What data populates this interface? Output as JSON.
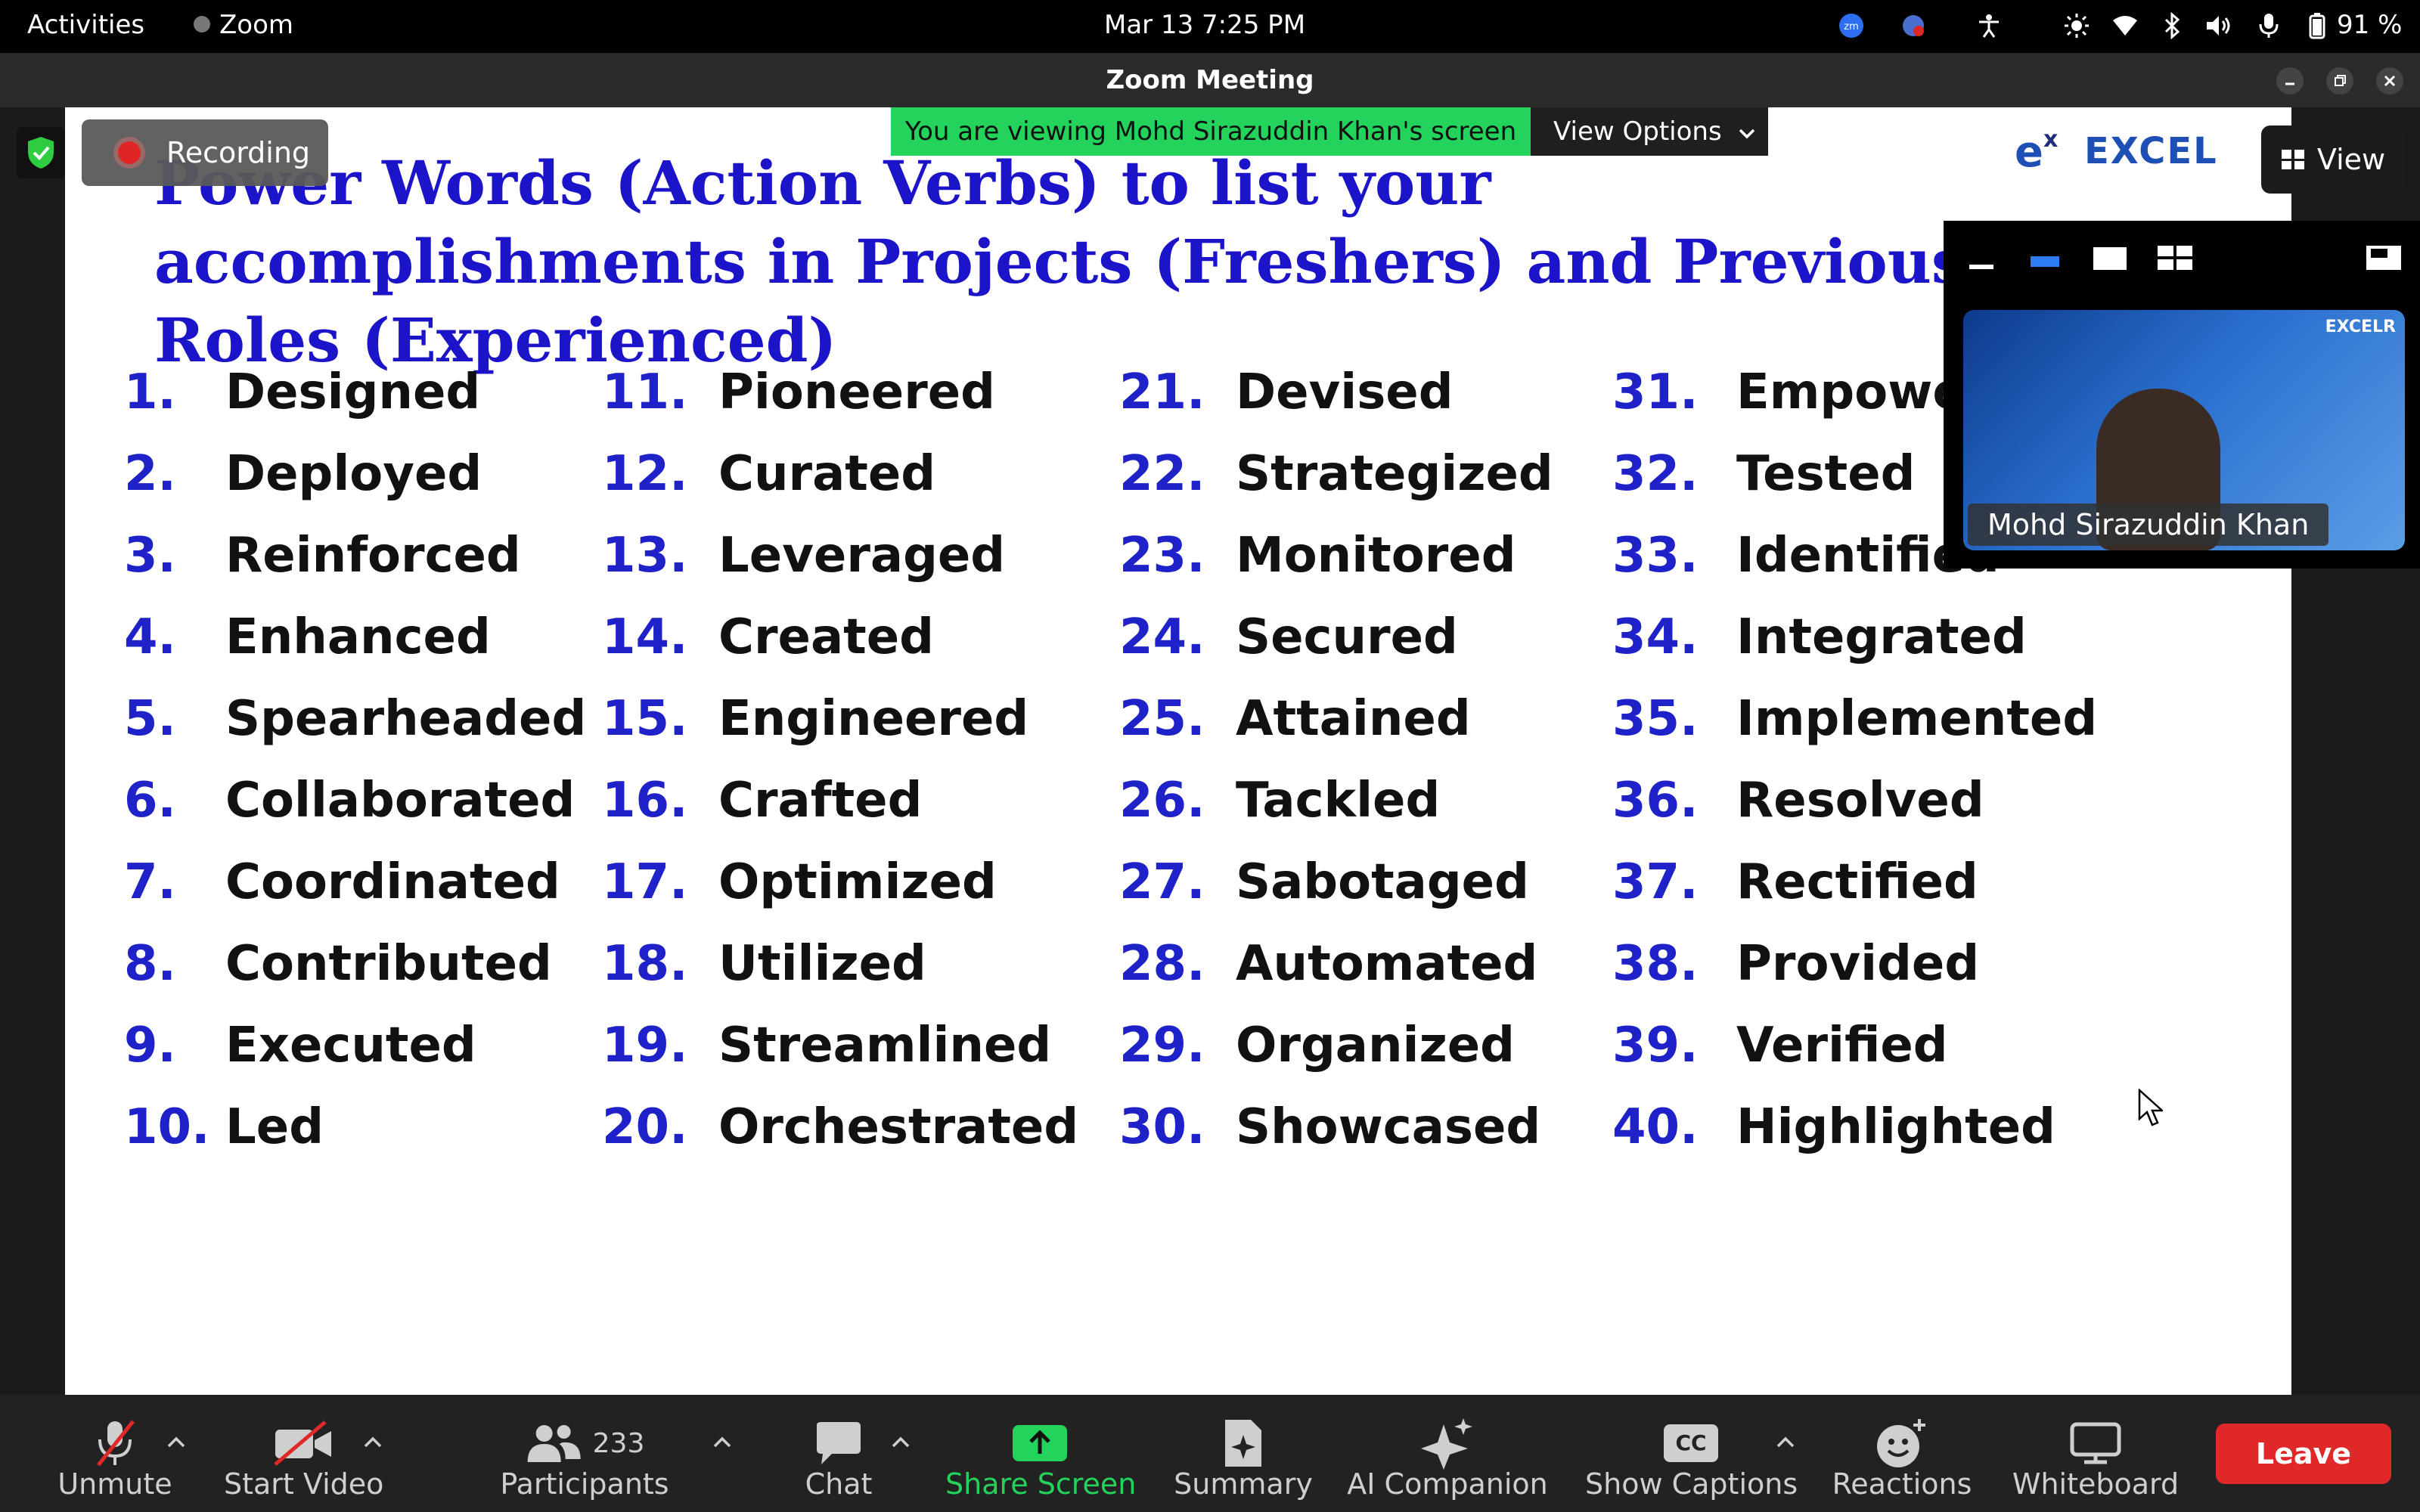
{
  "system_bar": {
    "activities": "Activities",
    "app_name": "Zoom",
    "datetime": "Mar 13  7:25 PM",
    "battery": "91 %"
  },
  "window": {
    "title": "Zoom Meeting"
  },
  "share": {
    "banner": "You are viewing Mohd Sirazuddin Khan's screen",
    "view_options": "View Options",
    "recording": "Recording",
    "view_button": "View",
    "logo_text": "EXCEL"
  },
  "slide": {
    "title": "Power Words (Action Verbs) to list your accomplishments in Projects (Freshers) and Previous Roles (Experienced)",
    "columns": [
      {
        "items": [
          {
            "num": "1.",
            "word": "Designed"
          },
          {
            "num": "2.",
            "word": "Deployed"
          },
          {
            "num": "3.",
            "word": "Reinforced"
          },
          {
            "num": "4.",
            "word": "Enhanced"
          },
          {
            "num": "5.",
            "word": "Spearheaded"
          },
          {
            "num": "6.",
            "word": "Collaborated"
          },
          {
            "num": "7.",
            "word": "Coordinated"
          },
          {
            "num": "8.",
            "word": "Contributed"
          },
          {
            "num": "9.",
            "word": "Executed"
          },
          {
            "num": "10.",
            "word": "Led"
          }
        ]
      },
      {
        "items": [
          {
            "num": "11.",
            "word": "Pioneered"
          },
          {
            "num": "12.",
            "word": "Curated"
          },
          {
            "num": "13.",
            "word": "Leveraged"
          },
          {
            "num": "14.",
            "word": "Created"
          },
          {
            "num": "15.",
            "word": "Engineered"
          },
          {
            "num": "16.",
            "word": "Crafted"
          },
          {
            "num": "17.",
            "word": "Optimized"
          },
          {
            "num": "18.",
            "word": "Utilized"
          },
          {
            "num": "19.",
            "word": "Streamlined"
          },
          {
            "num": "20.",
            "word": "Orchestrated"
          }
        ]
      },
      {
        "items": [
          {
            "num": "21.",
            "word": "Devised"
          },
          {
            "num": "22.",
            "word": "Strategized"
          },
          {
            "num": "23.",
            "word": "Monitored"
          },
          {
            "num": "24.",
            "word": "Secured"
          },
          {
            "num": "25.",
            "word": "Attained"
          },
          {
            "num": "26.",
            "word": "Tackled"
          },
          {
            "num": "27.",
            "word": "Sabotaged"
          },
          {
            "num": "28.",
            "word": "Automated"
          },
          {
            "num": "29.",
            "word": "Organized"
          },
          {
            "num": "30.",
            "word": "Showcased"
          }
        ]
      },
      {
        "items": [
          {
            "num": "31.",
            "word": "Empowe"
          },
          {
            "num": "32.",
            "word": "Tested"
          },
          {
            "num": "33.",
            "word": "Identified"
          },
          {
            "num": "34.",
            "word": "Integrated"
          },
          {
            "num": "35.",
            "word": "Implemented"
          },
          {
            "num": "36.",
            "word": "Resolved"
          },
          {
            "num": "37.",
            "word": "Rectified"
          },
          {
            "num": "38.",
            "word": "Provided"
          },
          {
            "num": "39.",
            "word": "Verified"
          },
          {
            "num": "40.",
            "word": "Highlighted"
          }
        ]
      }
    ]
  },
  "video_panel": {
    "participant_name": "Mohd Sirazuddin Khan",
    "tile_logo": "EXCELR"
  },
  "toolbar": {
    "unmute": "Unmute",
    "start_video": "Start Video",
    "participants": "Participants",
    "participants_count": "233",
    "chat": "Chat",
    "share_screen": "Share Screen",
    "summary": "Summary",
    "ai_companion": "AI Companion",
    "show_captions": "Show Captions",
    "captions_icon_text": "CC",
    "reactions": "Reactions",
    "whiteboard": "Whiteboard",
    "leave": "Leave"
  },
  "colors": {
    "slide_title": "#1c14c8",
    "number_blue": "#1e22c8",
    "banner_green": "#23d35b",
    "share_green": "#23d35b",
    "leave_red": "#e02828",
    "record_red": "#e02525"
  }
}
